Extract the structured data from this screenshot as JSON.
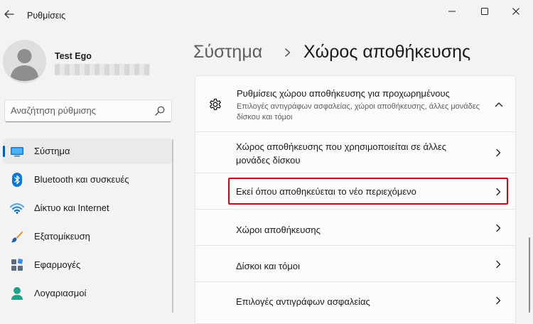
{
  "window": {
    "title": "Ρυθμίσεις",
    "icons": {
      "back": "arrow-left-icon",
      "minimize": "minimize-icon",
      "maximize": "maximize-icon",
      "close": "close-icon"
    }
  },
  "user": {
    "name": "Test Ego",
    "avatar_icon": "person-icon"
  },
  "search": {
    "placeholder": "Αναζήτηση ρύθμισης",
    "value": "",
    "icon": "search-icon"
  },
  "sidebar": {
    "items": [
      {
        "label": "Σύστημα",
        "icon": "monitor-icon",
        "active": true
      },
      {
        "label": "Bluetooth και συσκευές",
        "icon": "bluetooth-icon",
        "active": false
      },
      {
        "label": "Δίκτυο και Internet",
        "icon": "wifi-icon",
        "active": false
      },
      {
        "label": "Εξατομίκευση",
        "icon": "brush-icon",
        "active": false
      },
      {
        "label": "Εφαρμογές",
        "icon": "apps-icon",
        "active": false
      },
      {
        "label": "Λογαριασμοί",
        "icon": "account-icon",
        "active": false
      }
    ]
  },
  "breadcrumb": {
    "parent": "Σύστημα",
    "current": "Χώρος αποθήκευσης"
  },
  "advanced": {
    "title": "Ρυθμίσεις χώρου αποθήκευσης για προχωρημένους",
    "subtitle": "Επιλογές αντιγράφων ασφαλείας, χώροι αποθήκευσης, άλλες μονάδες δίσκου και τόμοι",
    "icon": "gear-icon",
    "expanded": true,
    "items": [
      {
        "label": "Χώρος αποθήκευσης που χρησιμοποιείται σε άλλες μονάδες δίσκου"
      },
      {
        "label": "Εκεί όπου αποθηκεύεται το νέο περιεχόμενο",
        "highlighted": true
      },
      {
        "label": "Χώροι αποθήκευσης"
      },
      {
        "label": "Δίσκοι και τόμοι"
      },
      {
        "label": "Επιλογές αντιγράφων ασφαλείας"
      }
    ]
  },
  "colors": {
    "accent": "#005fb8",
    "highlight": "#e00010",
    "background": "#f3f3f3",
    "card": "#fbfbfb"
  }
}
